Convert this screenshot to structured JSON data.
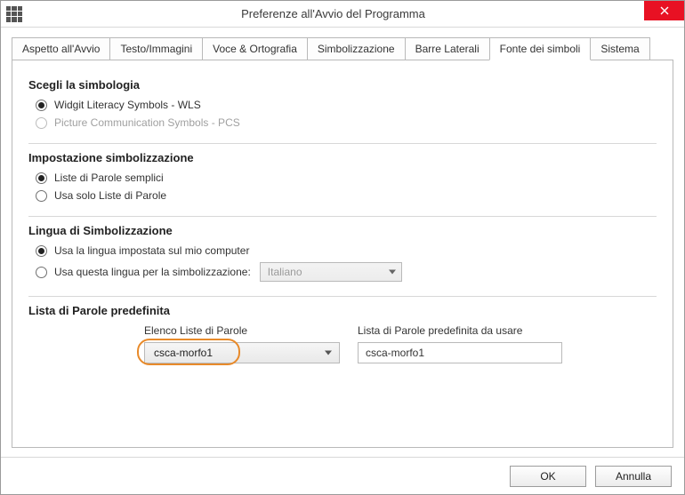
{
  "window": {
    "title": "Preferenze all'Avvio del Programma"
  },
  "tabs": {
    "t0": "Aspetto all'Avvio",
    "t1": "Testo/Immagini",
    "t2": "Voce & Ortografia",
    "t3": "Simbolizzazione",
    "t4": "Barre Laterali",
    "t5": "Fonte dei simboli",
    "t6": "Sistema"
  },
  "sections": {
    "symbology": {
      "title": "Scegli la simbologia",
      "opt_wls": "Widgit Literacy Symbols - WLS",
      "opt_pcs": "Picture Communication Symbols - PCS"
    },
    "symbolisation": {
      "title": "Impostazione simbolizzazione",
      "opt_semplici": "Liste di Parole semplici",
      "opt_solo": "Usa solo Liste di Parole"
    },
    "language": {
      "title": "Lingua di Simbolizzazione",
      "opt_computer": "Usa la lingua impostata sul mio computer",
      "opt_questa": "Usa questa lingua per la simbolizzazione:",
      "select_value": "Italiano"
    },
    "wordlist": {
      "title": "Lista di Parole predefinita",
      "col1_label": "Elenco Liste di Parole",
      "col2_label": "Lista di Parole predefinita da usare",
      "select_value": "csca-morfo1",
      "input_value": "csca-morfo1"
    }
  },
  "footer": {
    "ok": "OK",
    "cancel": "Annulla"
  }
}
